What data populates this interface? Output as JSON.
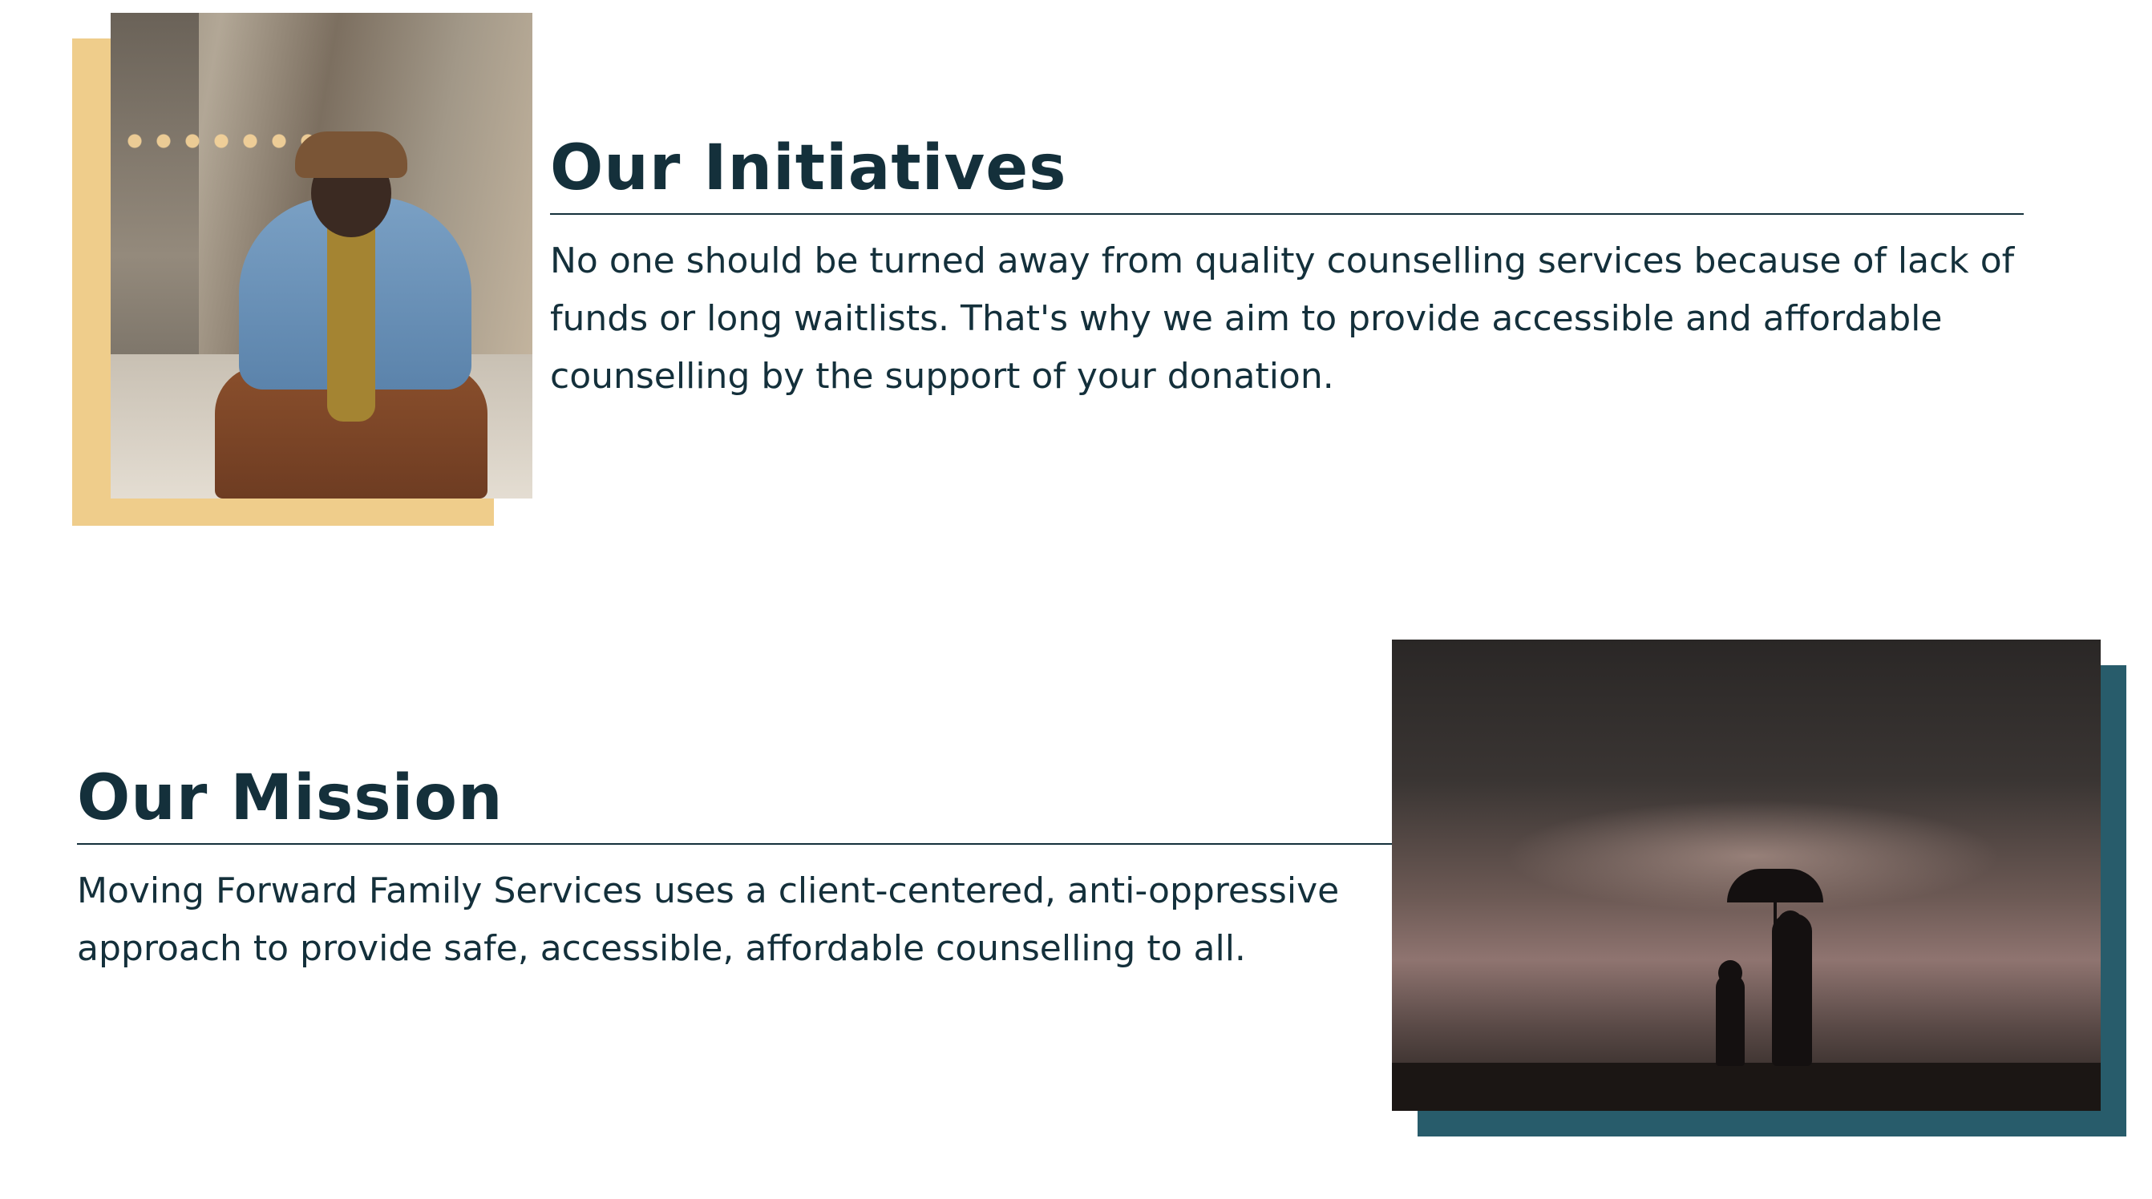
{
  "initiatives": {
    "title": "Our Initiatives",
    "body": "No one should be turned away from quality counselling services because of lack of funds or long waitlists. That's why we aim to provide accessible and affordable counselling by the support of your donation."
  },
  "mission": {
    "title": "Our Mission",
    "body": "Moving Forward Family Services uses a client-centered, anti-oppressive approach to provide safe, accessible, affordable counselling to all."
  },
  "colors": {
    "heading": "#14303b",
    "gold_accent": "#efcd8b",
    "teal_accent": "#285c6b"
  }
}
